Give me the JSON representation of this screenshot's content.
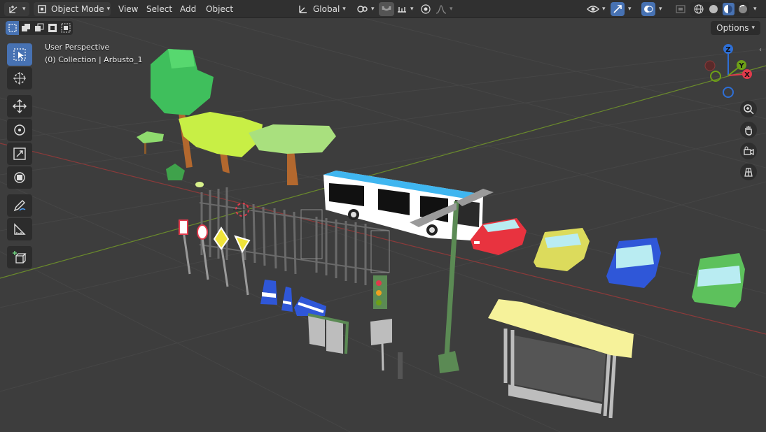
{
  "header": {
    "editor_type_icon": "3d-viewport-icon",
    "mode": {
      "label": "Object Mode",
      "icon": "object-mode-icon"
    },
    "menus": [
      "View",
      "Select",
      "Add",
      "Object"
    ],
    "transform_orientation": {
      "label": "Global",
      "icon": "orientation-icon"
    },
    "pivot_icon": "pivot-point-icon",
    "snap_icon": "snap-magnet-icon",
    "snap_target_icon": "snap-target-icon",
    "proportional_icon": "proportional-edit-icon",
    "falloff_icon": "falloff-curve-icon",
    "visibility_icon": "visibility-eye-icon",
    "gizmo_icon": "gizmo-icon",
    "overlay_icon": "overlay-icon",
    "xray_icon": "xray-icon",
    "shading_modes": [
      "wireframe",
      "solid",
      "material-preview",
      "rendered"
    ],
    "active_shading": "material-preview"
  },
  "viewport": {
    "view_name": "User Perspective",
    "collection_info": "(0) Collection | Arbusto_1",
    "options_label": "Options",
    "background": "#3d3d3d",
    "grid_color": "#454545",
    "x_axis_color": "#8c3a3a",
    "y_axis_color": "#6a8a2c"
  },
  "select_modes": [
    "set",
    "extend",
    "subtract",
    "invert",
    "intersect"
  ],
  "tools": [
    {
      "name": "select-box",
      "active": true
    },
    {
      "name": "cursor",
      "active": false
    },
    {
      "name": "move",
      "active": false
    },
    {
      "name": "rotate",
      "active": false
    },
    {
      "name": "scale",
      "active": false
    },
    {
      "name": "transform",
      "active": false
    },
    {
      "name": "annotate",
      "active": false
    },
    {
      "name": "measure",
      "active": false
    },
    {
      "name": "add-cube",
      "active": false
    }
  ],
  "gizmo": {
    "axes": [
      {
        "label": "Z",
        "color": "#2e6fd6"
      },
      {
        "label": "Y",
        "color": "#6ea017"
      },
      {
        "label": "X",
        "color": "#e03a4c"
      }
    ]
  },
  "nav_buttons": [
    "zoom-icon",
    "hand-pan-icon",
    "camera-icon",
    "ortho-grid-icon"
  ],
  "scene_colors": {
    "tree_green": "#3fbf5c",
    "tree_lime": "#c8ef45",
    "tree_light": "#a9e07e",
    "trunk": "#b3682e",
    "bus_top": "#3fb6f0",
    "car_red": "#e8333f",
    "car_yellow": "#dcdb5c",
    "car_blue": "#2f57d8",
    "car_green": "#5dc15c",
    "shelter_roof": "#f6f29a",
    "fence": "#6a6a6a",
    "lamp_pole": "#5b8a54"
  }
}
